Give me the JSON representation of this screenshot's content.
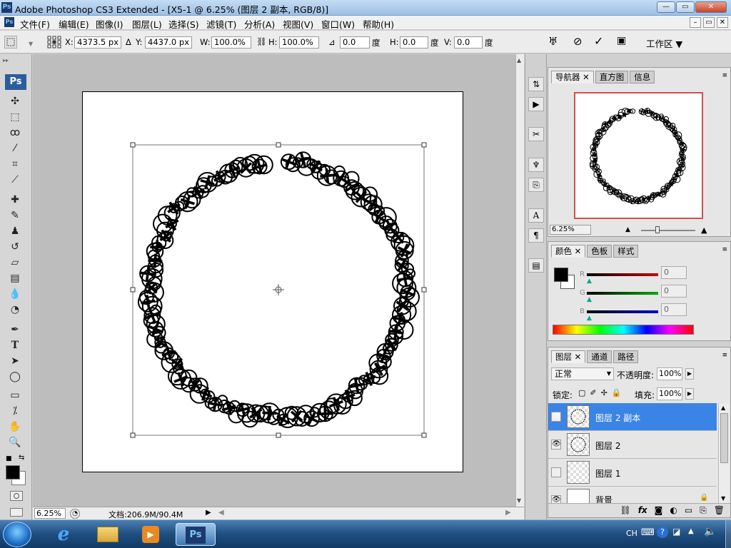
{
  "window": {
    "app_icon": "Ps",
    "title": "Adobe Photoshop CS3 Extended - [X5-1 @ 6.25% (图层 2 副本, RGB/8)]",
    "buttons": {
      "minimize": "—",
      "maximize": "▭",
      "close": "✕"
    }
  },
  "menubar": {
    "items": [
      "文件(F)",
      "编辑(E)",
      "图像(I)",
      "图层(L)",
      "选择(S)",
      "滤镜(T)",
      "分析(A)",
      "视图(V)",
      "窗口(W)",
      "帮助(H)"
    ],
    "doc_controls": [
      "–",
      "▭",
      "✕"
    ]
  },
  "options_bar": {
    "x_label": "X:",
    "x_value": "4373.5 px",
    "y_label": "Y:",
    "y_value": "4437.0 px",
    "w_label": "W:",
    "w_value": "100.0%",
    "h_label": "H:",
    "h_value": "100.0%",
    "angle_value": "0.0",
    "degree_unit": "度",
    "hskew_label": "H:",
    "hskew_value": "0.0",
    "vskew_label": "V:",
    "vskew_value": "0.0",
    "workspace_label": "工作区 ▼"
  },
  "toolbox": {
    "logo": "Ps",
    "tools": [
      "move-icon",
      "marquee-icon",
      "lasso-icon",
      "magic-wand-icon",
      "crop-icon",
      "slice-icon",
      "healing-icon",
      "brush-icon",
      "stamp-icon",
      "history-brush-icon",
      "eraser-icon",
      "gradient-icon",
      "blur-icon",
      "dodge-icon",
      "pen-icon",
      "type-icon",
      "path-select-icon",
      "shape-icon",
      "notes-icon",
      "eyedropper-icon",
      "hand-icon",
      "zoom-icon"
    ],
    "foreground_color": "#000000",
    "background_color": "#ffffff"
  },
  "status": {
    "zoom": "6.25%",
    "doc_size": "文档:206.9M/90.4M"
  },
  "navigator": {
    "tabs": [
      "导航器",
      "直方图",
      "信息"
    ],
    "zoom": "6.25%",
    "view_box_color": "#d05050"
  },
  "color_panel": {
    "tabs": [
      "颜色",
      "色板",
      "样式"
    ],
    "channels": [
      {
        "label": "R",
        "value": "0",
        "color": "#cc0000"
      },
      {
        "label": "G",
        "value": "0",
        "color": "#00aa00"
      },
      {
        "label": "B",
        "value": "0",
        "color": "#0000cc"
      }
    ]
  },
  "layers_panel": {
    "tabs": [
      "图层",
      "通道",
      "路径"
    ],
    "blend_mode": "正常",
    "opacity_label": "不透明度:",
    "opacity_value": "100%",
    "lock_label": "锁定:",
    "fill_label": "填充:",
    "fill_value": "100%",
    "layers": [
      {
        "name": "图层 2 副本",
        "visible": true,
        "selected": true
      },
      {
        "name": "图层 2",
        "visible": true,
        "selected": false
      },
      {
        "name": "图层 1",
        "visible": false,
        "selected": false
      },
      {
        "name": "背景",
        "visible": true,
        "selected": false
      }
    ],
    "footer_icons": [
      "link-icon",
      "fx-icon",
      "mask-icon",
      "adjustment-icon",
      "group-icon",
      "new-layer-icon",
      "delete-icon"
    ]
  },
  "taskbar": {
    "apps": [
      "start-icon",
      "ie-icon",
      "explorer-icon",
      "media-player-icon",
      "photoshop-icon"
    ],
    "photoshop_label": "Ps",
    "tray": {
      "lang": "CH"
    }
  }
}
